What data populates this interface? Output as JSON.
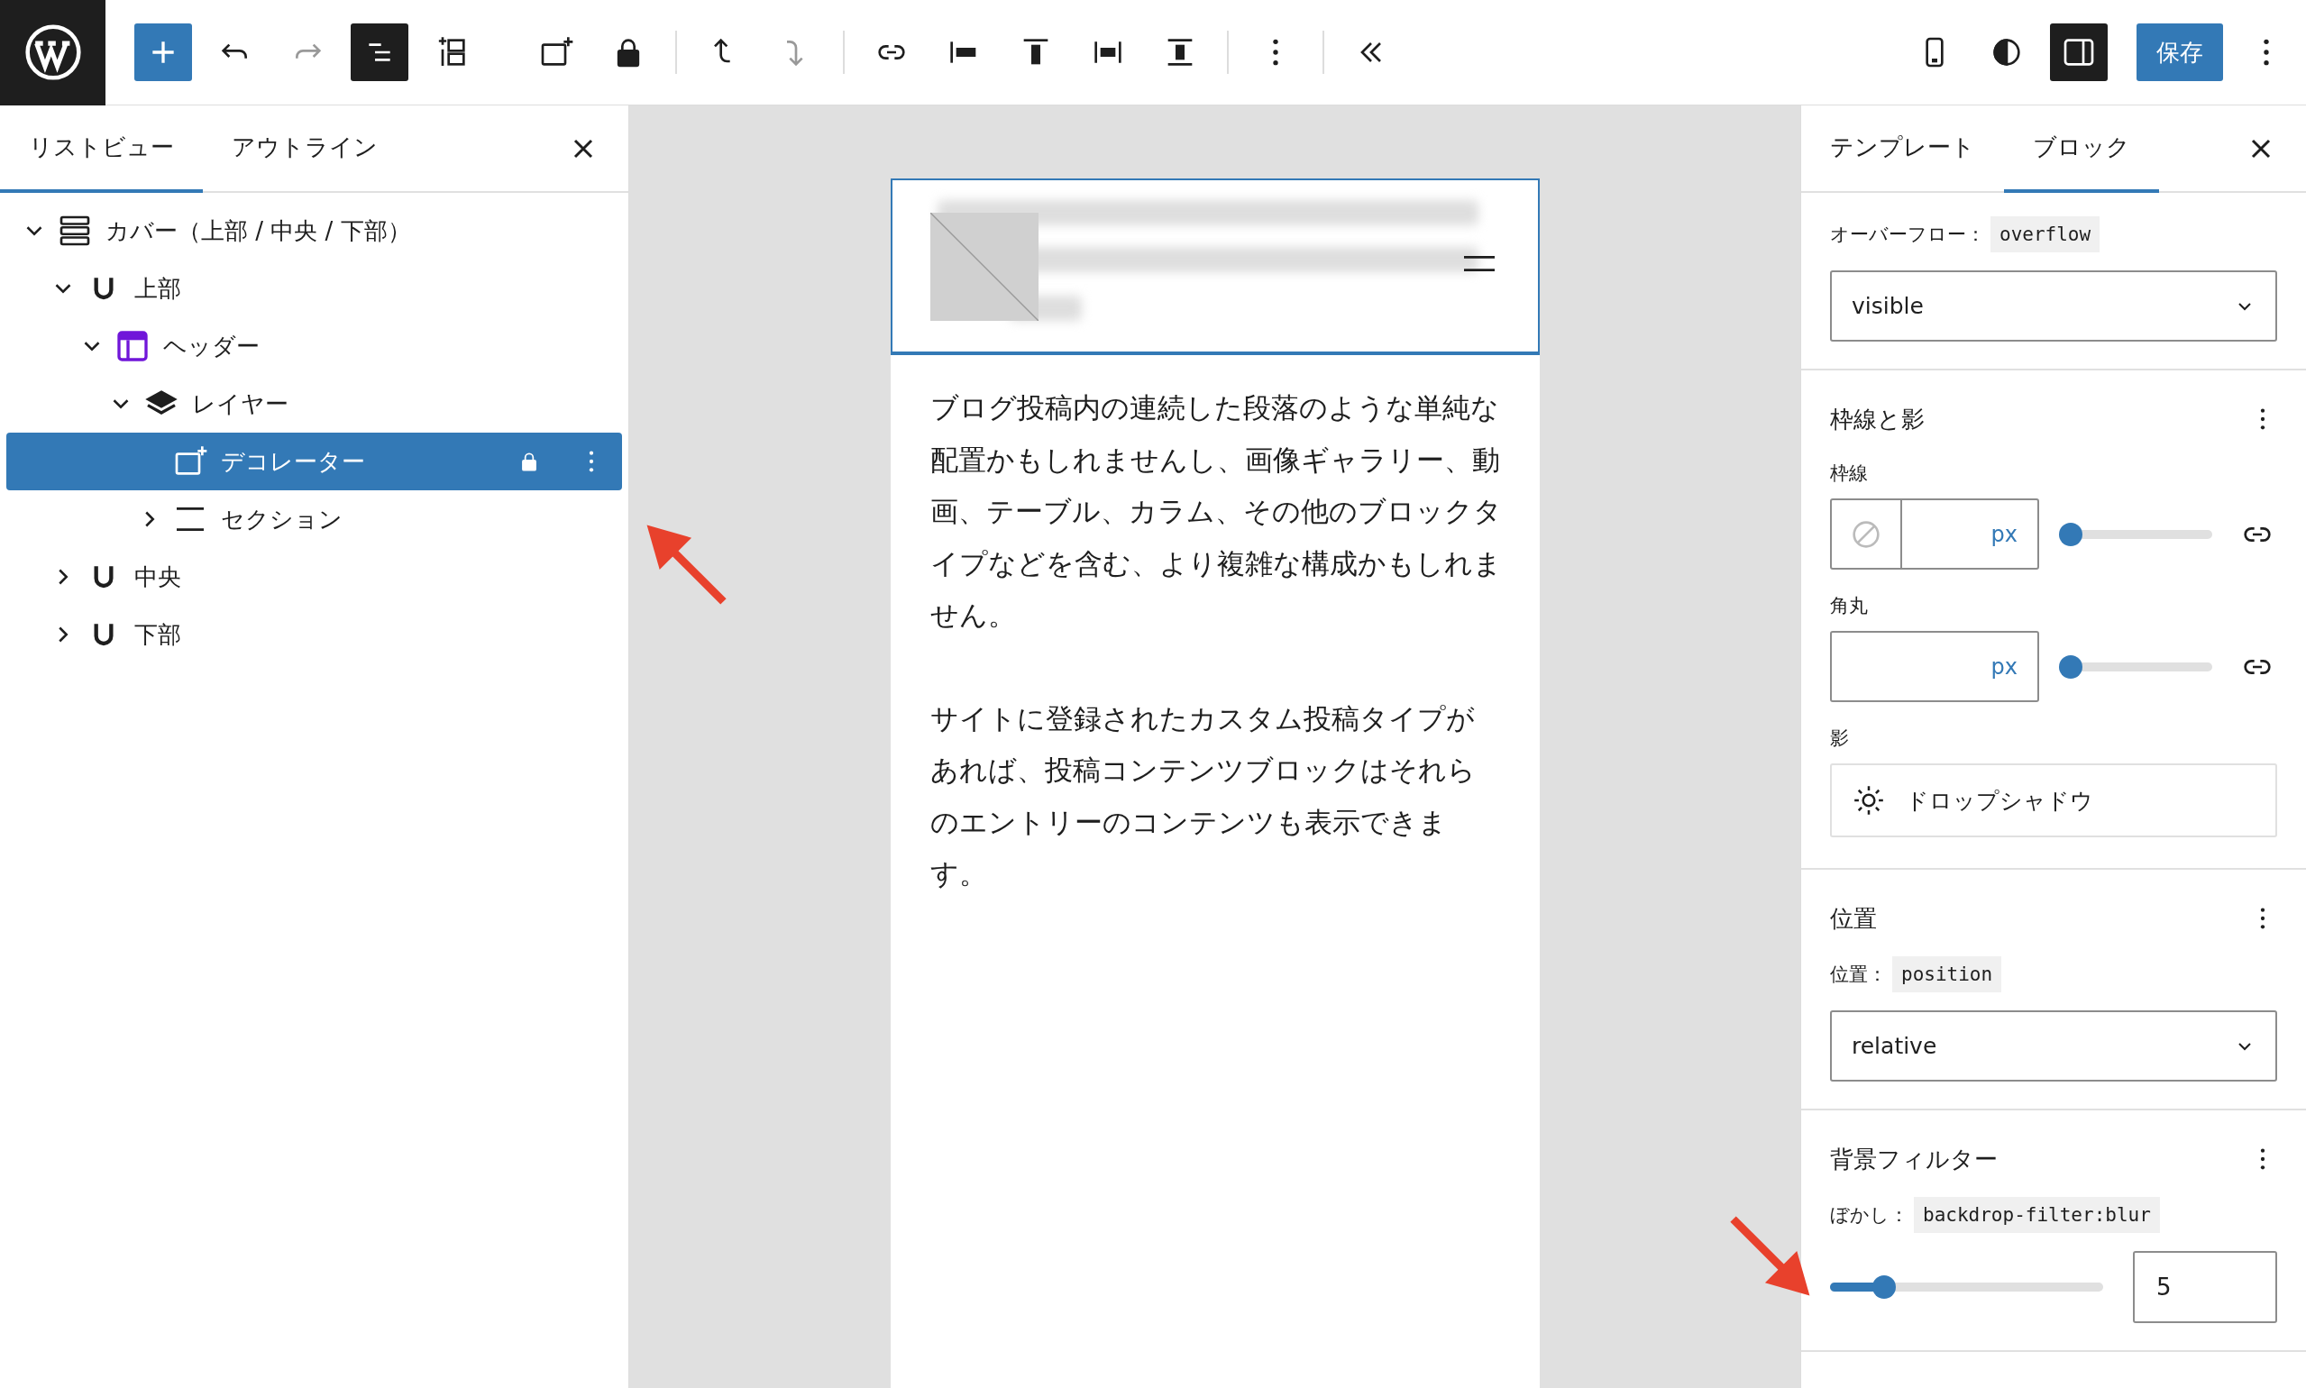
{
  "toolbar": {
    "groups": [
      {
        "tools": [
          {
            "kind": "add",
            "pressed": false,
            "disabled": false
          },
          {
            "kind": "undo",
            "pressed": false,
            "disabled": false
          },
          {
            "kind": "redo",
            "pressed": false,
            "disabled": true
          },
          {
            "kind": "list-view",
            "pressed": true,
            "disabled": false
          },
          {
            "kind": "block-grid",
            "pressed": false,
            "disabled": false
          },
          {
            "kind": "decorator",
            "pressed": false,
            "disabled": false
          },
          {
            "kind": "lock",
            "pressed": false,
            "disabled": false
          }
        ]
      },
      {
        "tools": [
          {
            "kind": "move-up",
            "pressed": false,
            "disabled": false
          },
          {
            "kind": "move-down",
            "pressed": false,
            "disabled": true
          }
        ]
      },
      {
        "tools": [
          {
            "kind": "link",
            "pressed": false,
            "disabled": false
          },
          {
            "kind": "justify-left",
            "pressed": false,
            "disabled": false
          },
          {
            "kind": "align-top",
            "pressed": false,
            "disabled": false
          },
          {
            "kind": "space-between",
            "pressed": false,
            "disabled": false
          },
          {
            "kind": "stretch",
            "pressed": false,
            "disabled": false
          }
        ]
      },
      {
        "tools": [
          {
            "kind": "more",
            "pressed": false,
            "disabled": false
          }
        ]
      },
      {
        "tools": [
          {
            "kind": "collapse",
            "pressed": false,
            "disabled": false
          }
        ]
      }
    ],
    "right_tools": [
      {
        "kind": "mobile",
        "pressed": false
      },
      {
        "kind": "contrast",
        "pressed": false
      },
      {
        "kind": "sidebar",
        "pressed": true
      },
      {
        "kind": "save",
        "label": "保存"
      },
      {
        "kind": "more",
        "pressed": false
      }
    ]
  },
  "list_view": {
    "tabs": [
      {
        "label": "リストビュー",
        "selected": true
      },
      {
        "label": "アウトライン",
        "selected": false
      }
    ],
    "tree": [
      {
        "label": "カバー（上部 / 中央 / 下部）",
        "kind": "cover",
        "expandable": true,
        "expanded": true,
        "selected": false,
        "locked": false,
        "children": [
          {
            "label": "上部",
            "kind": "group",
            "expandable": true,
            "expanded": true,
            "selected": false,
            "locked": false,
            "children": [
              {
                "label": "ヘッダー",
                "kind": "template-part",
                "expandable": true,
                "expanded": true,
                "selected": false,
                "locked": false,
                "children": [
                  {
                    "label": "レイヤー",
                    "kind": "layers",
                    "expandable": true,
                    "expanded": true,
                    "selected": false,
                    "locked": false,
                    "children": [
                      {
                        "label": "デコレーター",
                        "kind": "decorator",
                        "expandable": false,
                        "expanded": false,
                        "selected": true,
                        "locked": true
                      },
                      {
                        "label": "セクション",
                        "kind": "section",
                        "expandable": true,
                        "expanded": false,
                        "selected": false,
                        "locked": false
                      }
                    ]
                  }
                ]
              }
            ]
          },
          {
            "label": "中央",
            "kind": "group",
            "expandable": true,
            "expanded": false,
            "selected": false,
            "locked": false
          },
          {
            "label": "下部",
            "kind": "group",
            "expandable": true,
            "expanded": false,
            "selected": false,
            "locked": false
          }
        ]
      }
    ]
  },
  "canvas": {
    "header_selected": true,
    "paragraphs": [
      "ブログ投稿内の連続した段落のような単純な配置かもしれませんし、画像ギャラリー、動画、テーブル、カラム、その他のブロックタイプなどを含む、より複雑な構成かもしれません。",
      "サイトに登録されたカスタム投稿タイプがあれば、投稿コンテンツブロックはそれらのエントリーのコンテンツも表示できます。"
    ]
  },
  "settings": {
    "tabs": [
      {
        "label": "テンプレート",
        "selected": false
      },
      {
        "label": "ブロック",
        "selected": true
      }
    ],
    "overflow": {
      "label": "オーバーフロー：",
      "code": "overflow",
      "value": "visible"
    },
    "border_shadow": {
      "title": "枠線と影",
      "border": {
        "label": "枠線",
        "unit": "px",
        "level": 0
      },
      "radius": {
        "label": "角丸",
        "unit": "px",
        "level": 0
      },
      "shadow": {
        "label": "影",
        "button": "ドロップシャドウ"
      }
    },
    "position": {
      "title": "位置",
      "label": "位置：",
      "code": "position",
      "value": "relative"
    },
    "backdrop": {
      "title": "背景フィルター",
      "label": "ぼかし：",
      "code": "backdrop-filter:blur",
      "level": 0.17,
      "value": "5"
    }
  }
}
